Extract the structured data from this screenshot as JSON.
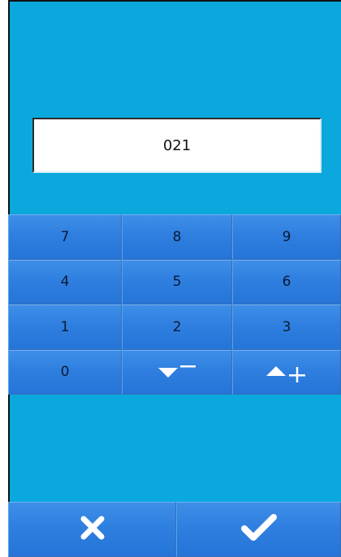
{
  "display": {
    "value": "021"
  },
  "keypad": {
    "keys": [
      {
        "label": "7"
      },
      {
        "label": "8"
      },
      {
        "label": "9"
      },
      {
        "label": "4"
      },
      {
        "label": "5"
      },
      {
        "label": "6"
      },
      {
        "label": "1"
      },
      {
        "label": "2"
      },
      {
        "label": "3"
      },
      {
        "label": "0"
      },
      {
        "icon": "decrement-icon"
      },
      {
        "icon": "increment-icon"
      }
    ]
  },
  "actions": {
    "cancel_icon": "close-icon",
    "confirm_icon": "check-icon"
  },
  "colors": {
    "background": "#0aa8dd",
    "key": "#2f7fe0",
    "icon": "#ffffff"
  }
}
